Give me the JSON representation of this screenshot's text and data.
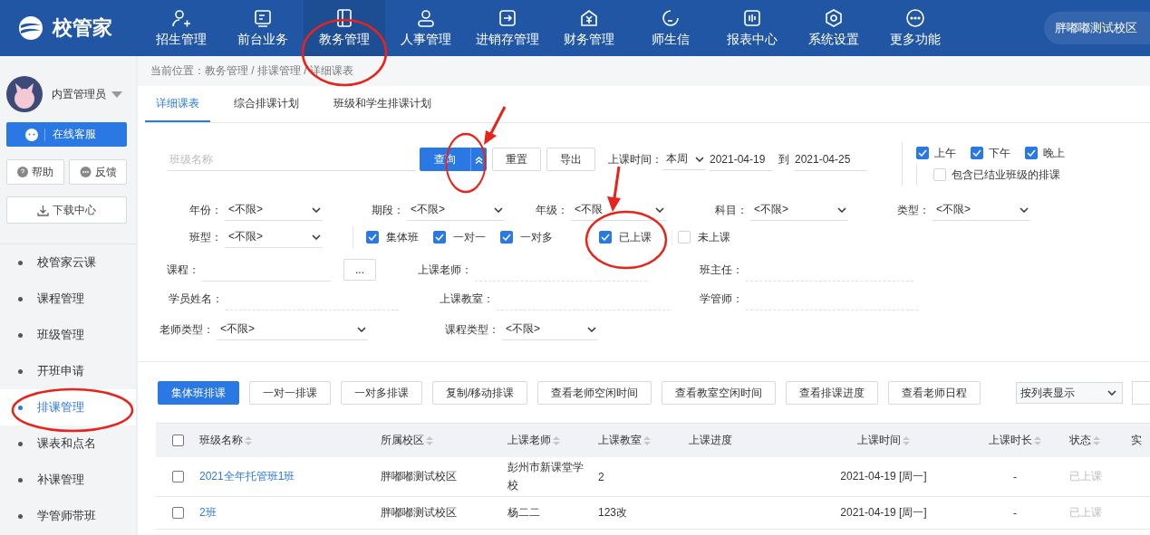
{
  "logo": {
    "text": "校管家"
  },
  "nav": [
    {
      "label": "招生管理",
      "selected": false,
      "highlighted": false
    },
    {
      "label": "前台业务",
      "selected": false,
      "highlighted": false
    },
    {
      "label": "教务管理",
      "selected": true,
      "highlighted": true
    },
    {
      "label": "人事管理",
      "selected": false,
      "highlighted": false
    },
    {
      "label": "进销存管理",
      "selected": false,
      "highlighted": false
    },
    {
      "label": "财务管理",
      "selected": false,
      "highlighted": false
    },
    {
      "label": "师生信",
      "selected": false,
      "highlighted": false
    },
    {
      "label": "报表中心",
      "selected": false,
      "highlighted": false
    },
    {
      "label": "系统设置",
      "selected": false,
      "highlighted": false
    },
    {
      "label": "更多功能",
      "selected": false,
      "highlighted": false
    }
  ],
  "campus": "胖嘟嘟测试校区",
  "user": {
    "name": "内置管理员"
  },
  "sidebar_buttons": {
    "service": "在线客服",
    "help": "帮助",
    "feedback": "反馈",
    "download": "下载中心"
  },
  "sidebar": [
    {
      "label": "校管家云课",
      "selected": false,
      "highlighted": false
    },
    {
      "label": "课程管理",
      "selected": false,
      "highlighted": false
    },
    {
      "label": "班级管理",
      "selected": false,
      "highlighted": false
    },
    {
      "label": "开班申请",
      "selected": false,
      "highlighted": false
    },
    {
      "label": "排课管理",
      "selected": true,
      "highlighted": true
    },
    {
      "label": "课表和点名",
      "selected": false,
      "highlighted": false
    },
    {
      "label": "补课管理",
      "selected": false,
      "highlighted": false
    },
    {
      "label": "学管师带班",
      "selected": false,
      "highlighted": false
    }
  ],
  "breadcrumb": "当前位置：教务管理 / 排课管理 / 详细课表",
  "tabs": [
    {
      "label": "详细课表",
      "selected": true
    },
    {
      "label": "综合排课计划",
      "selected": false
    },
    {
      "label": "班级和学生排课计划",
      "selected": false
    }
  ],
  "search": {
    "placeholder": "班级名称",
    "query": "查询",
    "expand_highlighted": true,
    "reset": "重置",
    "export": "导出"
  },
  "time_filter": {
    "label": "上课时间：",
    "range": "本周",
    "from": "2021-04-19",
    "to": "到",
    "until": "2021-04-25"
  },
  "periods": [
    {
      "label": "上午",
      "checked": true
    },
    {
      "label": "下午",
      "checked": true
    },
    {
      "label": "晚上",
      "checked": true
    }
  ],
  "include_graduated": {
    "label": "包含已结业班级的排课",
    "checked": false
  },
  "selects": [
    {
      "label": "年份：",
      "value": "<不限>"
    },
    {
      "label": "期段：",
      "value": "<不限>"
    },
    {
      "label": "年级：",
      "value": "<不限"
    },
    {
      "label": "科目：",
      "value": "<不限>"
    },
    {
      "label": "类型：",
      "value": "<不限>"
    }
  ],
  "class_type": {
    "label": "班型：",
    "value": "<不限>"
  },
  "class_kinds": [
    {
      "label": "集体班",
      "checked": true
    },
    {
      "label": "一对一",
      "checked": true
    },
    {
      "label": "一对多",
      "checked": true
    }
  ],
  "lesson_status": [
    {
      "label": "已上课",
      "checked": true,
      "highlighted": true
    },
    {
      "label": "未上课",
      "checked": false,
      "highlighted": false
    }
  ],
  "course": {
    "label": "课程：",
    "button": "..."
  },
  "teacher": {
    "label": "上课老师："
  },
  "head_teacher": {
    "label": "班主任："
  },
  "student": {
    "label": "学员姓名："
  },
  "classroom": {
    "label": "上课教室："
  },
  "advisor": {
    "label": "学管师："
  },
  "teacher_type": {
    "label": "老师类型：",
    "value": "<不限>"
  },
  "course_type": {
    "label": "课程类型：",
    "value": "<不限>"
  },
  "actions": [
    {
      "label": "集体班排课",
      "primary": true
    },
    {
      "label": "一对一排课",
      "primary": false
    },
    {
      "label": "一对多排课",
      "primary": false
    },
    {
      "label": "复制/移动排课",
      "primary": false
    },
    {
      "label": "查看老师空闲时间",
      "primary": false
    },
    {
      "label": "查看教室空闲时间",
      "primary": false
    },
    {
      "label": "查看排课进度",
      "primary": false
    },
    {
      "label": "查看老师日程",
      "primary": false
    }
  ],
  "view_select": "按列表显示",
  "table": {
    "select_all": false,
    "columns": [
      {
        "label": "班级名称",
        "sortable": true
      },
      {
        "label": "所属校区",
        "sortable": true
      },
      {
        "label": "上课老师",
        "sortable": true
      },
      {
        "label": "上课教室",
        "sortable": true
      },
      {
        "label": "上课进度",
        "sortable": false
      },
      {
        "label": "上课时间",
        "sortable": true
      },
      {
        "label": "上课时长",
        "sortable": true
      },
      {
        "label": "状态",
        "sortable": true
      },
      {
        "label": "实",
        "sortable": false
      }
    ],
    "rows": [
      {
        "checked": false,
        "class_name": "2021全年托管班1班",
        "campus": "胖嘟嘟测试校区",
        "teacher": "彭州市新课堂学校",
        "room": "2",
        "time": "2021-04-19 [周一]",
        "duration": "-",
        "status": "已上课"
      },
      {
        "checked": false,
        "class_name": "2班",
        "campus": "胖嘟嘟测试校区",
        "teacher": "杨二二",
        "room": "123改",
        "time": "2021-04-19 [周一]",
        "duration": "-",
        "status": "已上课"
      }
    ]
  }
}
